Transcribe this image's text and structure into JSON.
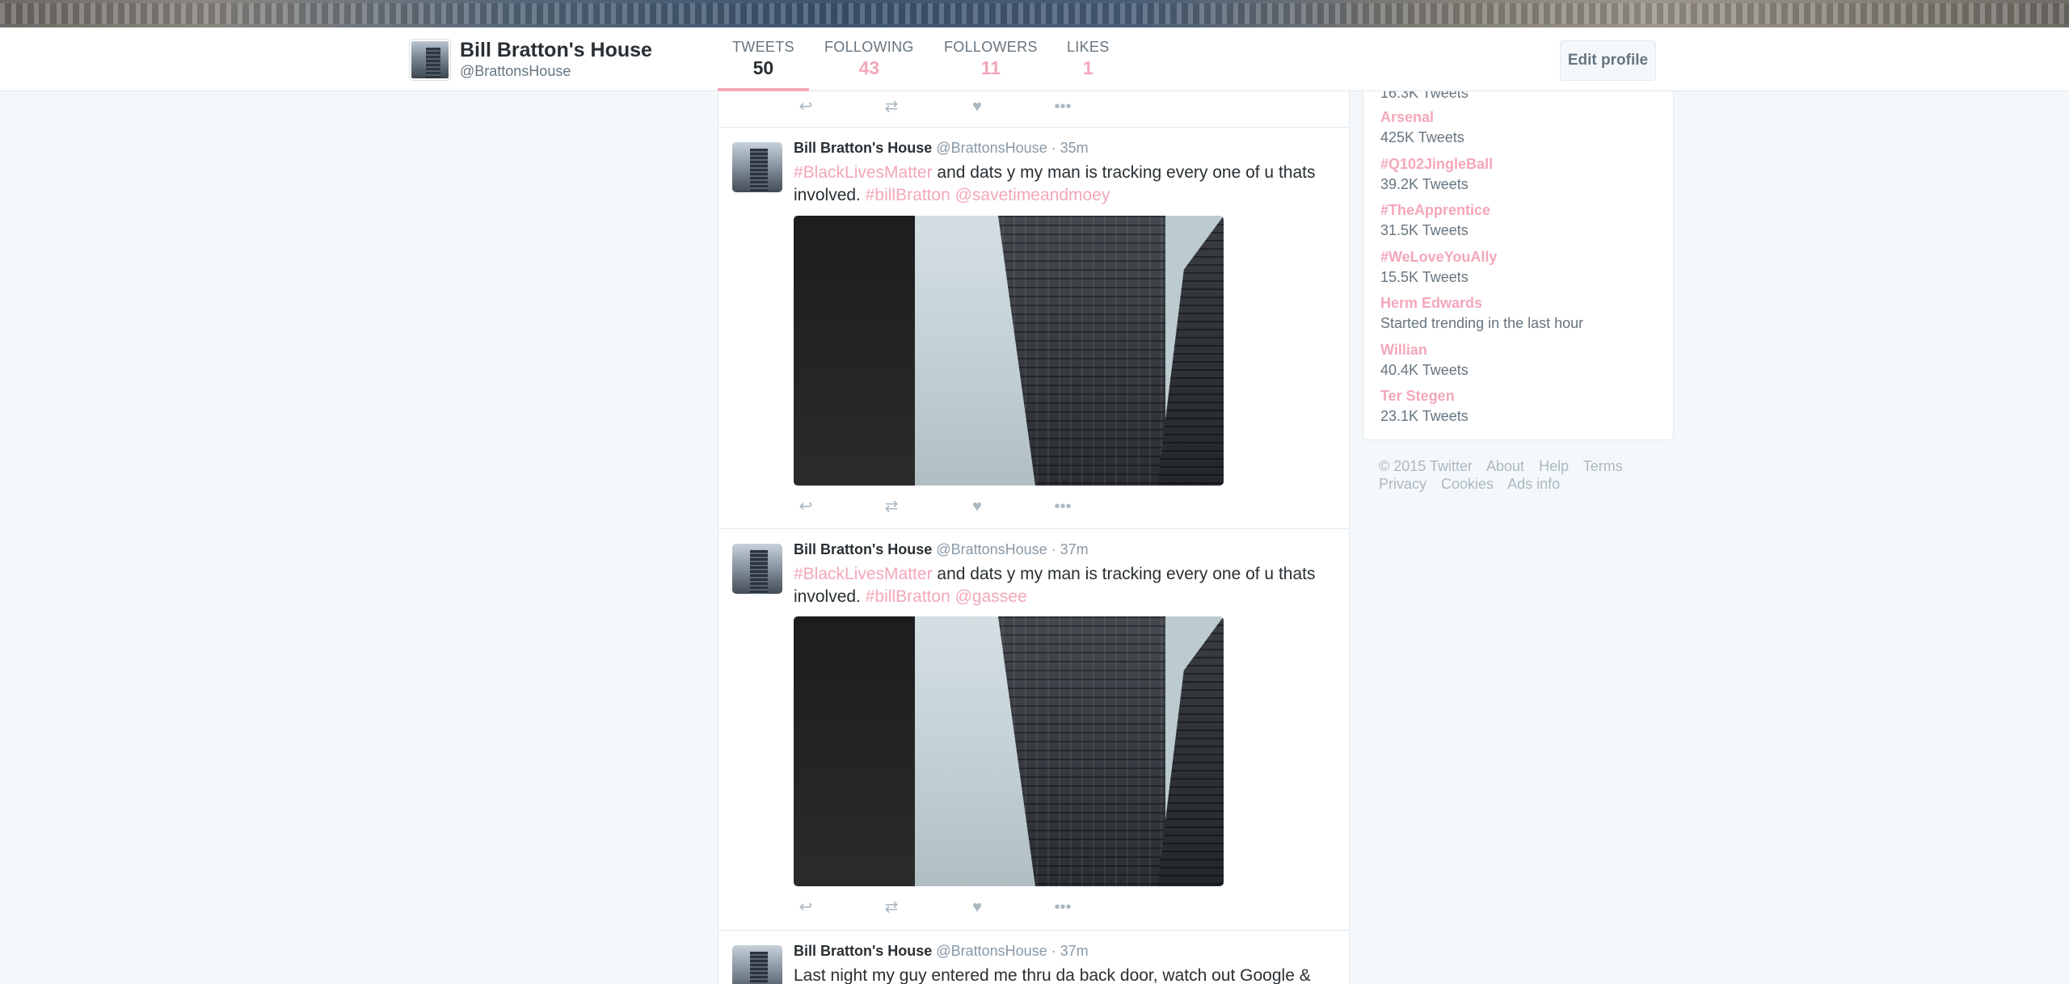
{
  "profile": {
    "name": "Bill Bratton's House",
    "handle": "@BrattonsHouse",
    "edit_label": "Edit profile"
  },
  "stats": [
    {
      "label": "TWEETS",
      "value": "50"
    },
    {
      "label": "FOLLOWING",
      "value": "43"
    },
    {
      "label": "FOLLOWERS",
      "value": "11"
    },
    {
      "label": "LIKES",
      "value": "1"
    }
  ],
  "tweets": [
    {
      "name": "Bill Bratton's House",
      "meta": "@BrattonsHouse · 35m",
      "hashtag": "#BlackLivesMatter",
      "text": " and dats y my man is tracking every one of u thats involved. ",
      "links": "#billBratton @savetimeandmoey"
    },
    {
      "name": "Bill Bratton's House",
      "meta": "@BrattonsHouse · 37m",
      "hashtag": "#BlackLivesMatter",
      "text": " and dats y my man is tracking every one of u thats involved. ",
      "links": "#billBratton @gassee"
    },
    {
      "name": "Bill Bratton's House",
      "meta": "@BrattonsHouse · 37m",
      "text": "Last night my guy entered me thru da back door, watch out Google &"
    }
  ],
  "actions": {
    "reply": "reply-icon",
    "retweet": "retweet-icon",
    "like": "heart-icon",
    "more": "more-icon"
  },
  "trends": {
    "top_partial": "16.3K Tweets",
    "items": [
      {
        "name": "Arsenal",
        "stat": "425K Tweets"
      },
      {
        "name": "#Q102JingleBall",
        "stat": "39.2K Tweets"
      },
      {
        "name": "#TheApprentice",
        "stat": "31.5K Tweets"
      },
      {
        "name": "#WeLoveYouAlly",
        "stat": "15.5K Tweets"
      },
      {
        "name": "Herm Edwards",
        "stat": "Started trending in the last hour"
      },
      {
        "name": "Willian",
        "stat": "40.4K Tweets"
      },
      {
        "name": "Ter Stegen",
        "stat": "23.1K Tweets"
      }
    ]
  },
  "footer": {
    "copyright": "© 2015 Twitter",
    "links_row1": [
      "About",
      "Help",
      "Terms"
    ],
    "links_row2": [
      "Privacy",
      "Cookies",
      "Ads info"
    ]
  },
  "colors": {
    "link": "#f4a7b9",
    "text": "#292f33",
    "muted": "#66757f",
    "background": "#f5f8fa"
  }
}
